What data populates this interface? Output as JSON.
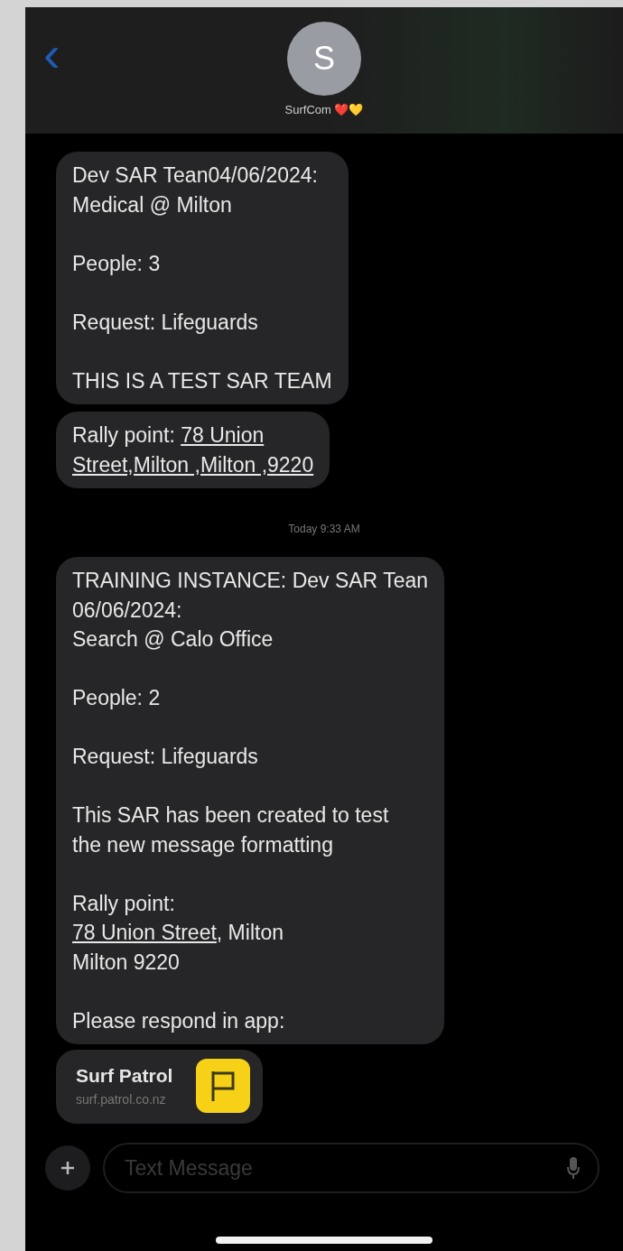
{
  "header": {
    "back": "‹",
    "avatar_initial": "S",
    "contact_name": "SurfCom ❤️💛"
  },
  "messages": [
    {
      "kind": "bubble",
      "paragraphs": [
        [
          [
            {
              "text": "Dev SAR Tean04/06/2024:"
            }
          ],
          [
            {
              "text": "Medical @ Milton"
            }
          ]
        ],
        [
          [
            {
              "text": "People: 3"
            }
          ]
        ],
        [
          [
            {
              "text": "Request: Lifeguards"
            }
          ]
        ],
        [
          [
            {
              "text": "THIS IS A TEST SAR TEAM"
            }
          ]
        ]
      ]
    },
    {
      "kind": "bubble",
      "paragraphs": [
        [
          [
            {
              "text": "Rally point: "
            },
            {
              "text": "78 Union",
              "link": true
            }
          ],
          [
            {
              "text": "Street,Milton ,Milton ,9220",
              "link": true
            }
          ]
        ]
      ]
    },
    {
      "kind": "timestamp",
      "text": "Today 9:33 AM"
    },
    {
      "kind": "bubble",
      "paragraphs": [
        [
          [
            {
              "text": "TRAINING INSTANCE: Dev SAR Tean"
            }
          ],
          [
            {
              "text": "06/06/2024:"
            }
          ],
          [
            {
              "text": "Search @ Calo Office"
            }
          ]
        ],
        [
          [
            {
              "text": "People: 2"
            }
          ]
        ],
        [
          [
            {
              "text": "Request: Lifeguards"
            }
          ]
        ],
        [
          [
            {
              "text": "This SAR has been created to test"
            }
          ],
          [
            {
              "text": "the new message formatting"
            }
          ]
        ],
        [
          [
            {
              "text": "Rally point:"
            }
          ],
          [
            {
              "text": "78 Union Street",
              "link": true
            },
            {
              "text": ", Milton"
            }
          ],
          [
            {
              "text": "Milton  9220"
            }
          ]
        ],
        [
          [
            {
              "text": "Please respond in app:"
            }
          ]
        ]
      ]
    },
    {
      "kind": "link_card",
      "title": "Surf Patrol",
      "url": "surf.patrol.co.nz"
    }
  ],
  "composer": {
    "placeholder": "Text Message"
  }
}
